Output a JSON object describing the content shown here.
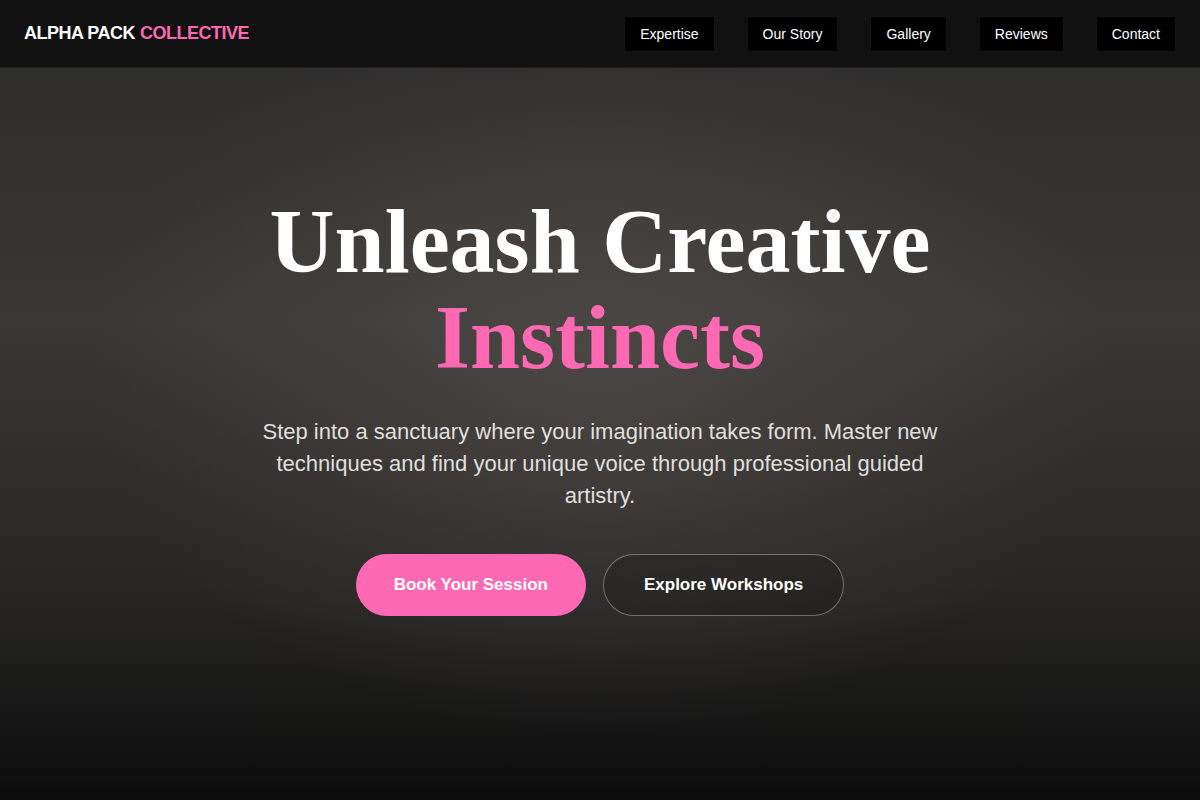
{
  "brand": {
    "name": "ALPHA PACK",
    "accent": "COLLECTIVE"
  },
  "nav": {
    "items": [
      "Expertise",
      "Our Story",
      "Gallery",
      "Reviews",
      "Contact"
    ]
  },
  "hero": {
    "title": "Unleash Creative",
    "title_accent": "Instincts",
    "subtitle": "Step into a sanctuary where your imagination takes form. Master new techniques and find your unique voice through professional guided artistry.",
    "buttons": [
      {
        "label": "Book Your Session",
        "kind": "primary"
      },
      {
        "label": "Explore Workshops",
        "kind": "secondary"
      }
    ]
  }
}
